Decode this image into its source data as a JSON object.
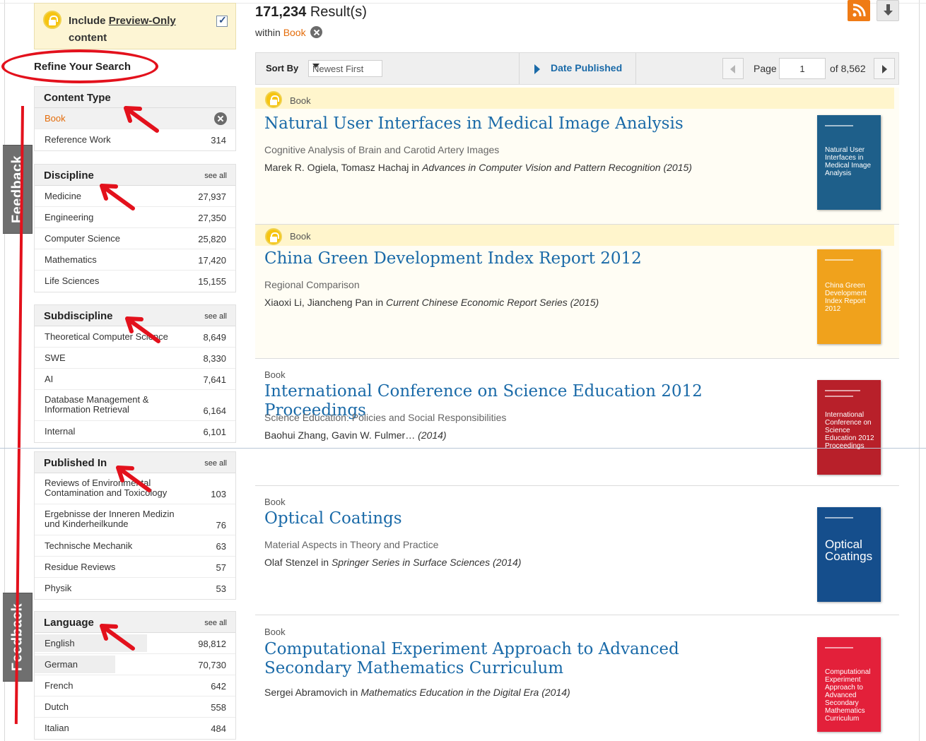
{
  "preview_toggle": {
    "label_prefix": "Include ",
    "label_link": "Preview-Only",
    "label_suffix": "content",
    "checked": true
  },
  "refine_heading": "Refine Your Search",
  "feedback_label": "Feedback",
  "facets": {
    "content_type": {
      "title": "Content Type",
      "items": [
        {
          "label": "Book",
          "selected": true
        },
        {
          "label": "Reference Work",
          "count": "314"
        }
      ]
    },
    "discipline": {
      "title": "Discipline",
      "see_all": "see all",
      "items": [
        {
          "label": "Medicine",
          "count": "27,937"
        },
        {
          "label": "Engineering",
          "count": "27,350"
        },
        {
          "label": "Computer Science",
          "count": "25,820"
        },
        {
          "label": "Mathematics",
          "count": "17,420"
        },
        {
          "label": "Life Sciences",
          "count": "15,155"
        }
      ]
    },
    "subdiscipline": {
      "title": "Subdiscipline",
      "see_all": "see all",
      "items": [
        {
          "label": "Theoretical Computer Science",
          "count": "8,649"
        },
        {
          "label": "SWE",
          "count": "8,330"
        },
        {
          "label": "AI",
          "count": "7,641"
        },
        {
          "label": "Database Management & Information Retrieval",
          "count": "6,164"
        },
        {
          "label": "Internal",
          "count": "6,101"
        }
      ]
    },
    "published_in": {
      "title": "Published In",
      "see_all": "see all",
      "items": [
        {
          "label": "Reviews of Environmental Contamination and Toxicology",
          "count": "103"
        },
        {
          "label": "Ergebnisse der Inneren Medizin und Kinderheilkunde",
          "count": "76"
        },
        {
          "label": "Technische Mechanik",
          "count": "63"
        },
        {
          "label": "Residue Reviews",
          "count": "57"
        },
        {
          "label": "Physik",
          "count": "53"
        }
      ]
    },
    "language": {
      "title": "Language",
      "see_all": "see all",
      "items": [
        {
          "label": "English",
          "count": "98,812",
          "share": 0.56
        },
        {
          "label": "German",
          "count": "70,730",
          "share": 0.4
        },
        {
          "label": "French",
          "count": "642"
        },
        {
          "label": "Dutch",
          "count": "558"
        },
        {
          "label": "Italian",
          "count": "484"
        }
      ]
    }
  },
  "results_header": {
    "count": "171,234",
    "count_suffix": " Result(s)",
    "within_label": "within ",
    "within_value": "Book"
  },
  "sortbar": {
    "sort_by_label": "Sort By",
    "sort_value": "Newest First",
    "date_published": "Date Published",
    "page_label": "Page",
    "page_value": "1",
    "page_of": "of 8,562"
  },
  "results": [
    {
      "type": "Book",
      "title": "Natural User Interfaces in Medical Image Analysis",
      "subtitle": "Cognitive Analysis of Brain and Carotid Artery Images",
      "authors": "Marek R. Ogiela, Tomasz Hachaj",
      "in_label": " in ",
      "series": "Advances in Computer Vision and Pattern Recognition (2015)",
      "preview_only": true,
      "cover_title": "Natural User Interfaces in Medical Image Analysis",
      "cover_color": "#1e5f8a"
    },
    {
      "type": "Book",
      "title": "China Green Development Index Report 2012",
      "subtitle": "Regional Comparison",
      "authors": "Xiaoxi Li, Jiancheng Pan",
      "in_label": " in ",
      "series": "Current Chinese Economic Report Series (2015)",
      "preview_only": true,
      "cover_title": "China Green Development Index Report 2012",
      "cover_color": "#f0a21c"
    },
    {
      "type": "Book",
      "title": "International Conference on Science Education 2012 Proceedings",
      "subtitle": "Science Education: Policies and Social Responsibilities",
      "authors": "Baohui Zhang, Gavin W. Fulmer…",
      "series": " (2014)",
      "preview_only": false,
      "cover_title": "International Conference on Science Education 2012 Proceedings",
      "cover_color": "#b8202a"
    },
    {
      "type": "Book",
      "title": "Optical Coatings",
      "subtitle": "Material Aspects in Theory and Practice",
      "authors": "Olaf Stenzel",
      "in_label": " in ",
      "series": "Springer Series in Surface Sciences (2014)",
      "preview_only": false,
      "cover_title": "Optical Coatings",
      "cover_color": "#154e8c"
    },
    {
      "type": "Book",
      "title": "Computational Experiment Approach to Advanced Secondary Mathematics Curriculum",
      "authors": "Sergei Abramovich",
      "in_label": " in ",
      "series": "Mathematics Education in the Digital Era (2014)",
      "preview_only": false,
      "cover_title": "Computational Experiment Approach to Advanced Secondary Mathematics Curriculum",
      "cover_color": "#e3203a"
    }
  ],
  "colors": {
    "accent_link": "#1a6aa8",
    "accent_orange": "#e46c0a",
    "annotation_red": "#e3111c",
    "preview_bg": "#fdf5d4"
  }
}
